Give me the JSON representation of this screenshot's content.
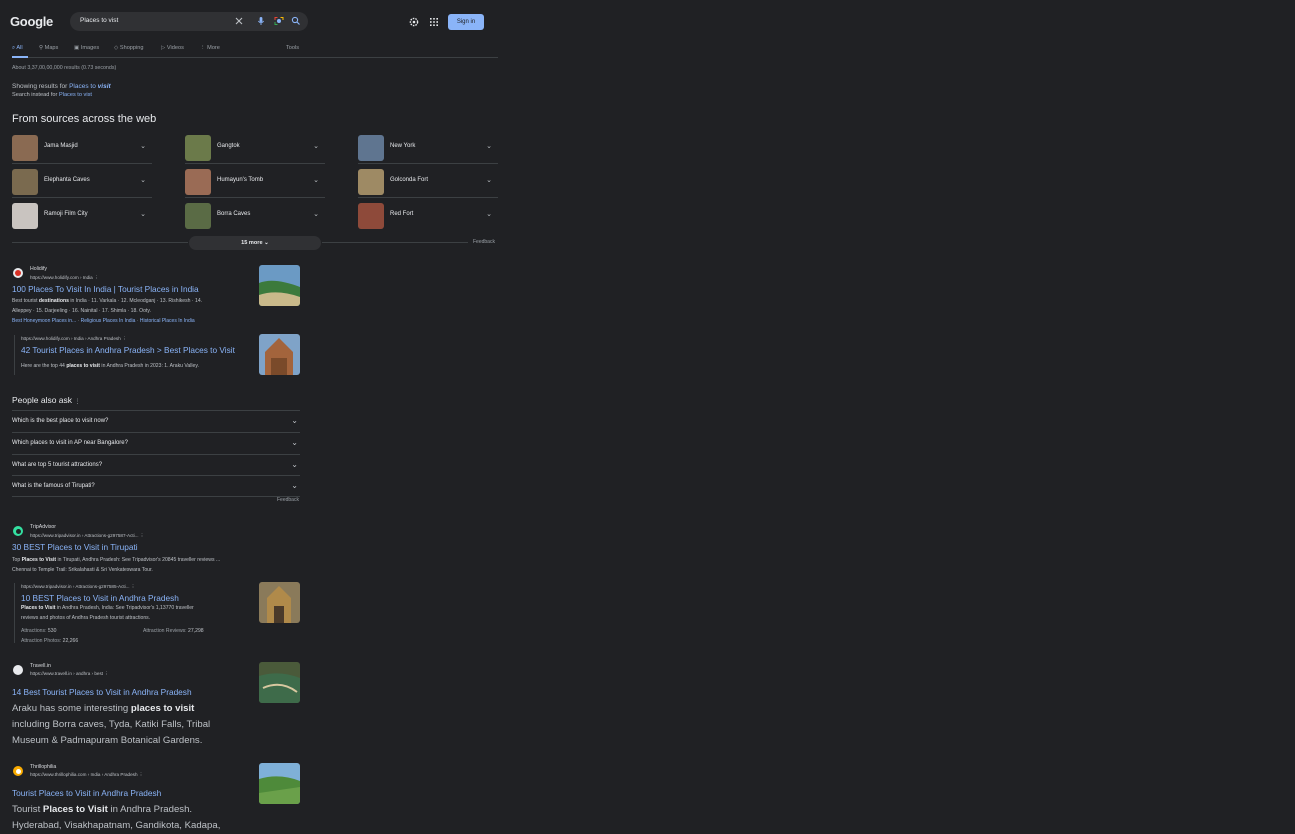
{
  "header": {
    "logo": "Google",
    "query": "Places to vist",
    "signin": "Sign in"
  },
  "tabs": [
    {
      "label": "All"
    },
    {
      "label": "Maps"
    },
    {
      "label": "Images"
    },
    {
      "label": "Shopping"
    },
    {
      "label": "Videos"
    },
    {
      "label": "More"
    },
    {
      "label": "Tools"
    }
  ],
  "stats": "About 3,37,00,00,000 results (0.73 seconds)",
  "correction": {
    "showing_prefix": "Showing results for",
    "showing_plain": "Places to",
    "showing_bold": "visit",
    "instead_prefix": "Search instead for",
    "instead_link": "Places to vist"
  },
  "sources": {
    "heading": "From sources across the web",
    "items": [
      {
        "name": "Jama Masjid",
        "color": "#8a6a52"
      },
      {
        "name": "Gangtok",
        "color": "#6b7a4a"
      },
      {
        "name": "New York",
        "color": "#5f7590"
      },
      {
        "name": "Elephanta Caves",
        "color": "#7a6a4f"
      },
      {
        "name": "Humayun's Tomb",
        "color": "#9a6b55"
      },
      {
        "name": "Golconda Fort",
        "color": "#9e8a64"
      },
      {
        "name": "Ramoji Film City",
        "color": "#c9c4c0"
      },
      {
        "name": "Borra Caves",
        "color": "#5a6b45"
      },
      {
        "name": "Red Fort",
        "color": "#8e4a3a"
      }
    ],
    "more": "15 more",
    "feedback": "Feedback"
  },
  "results": {
    "holidify": {
      "site": "Holidify",
      "url": "https://www.holidify.com › India",
      "title": "100 Places To Visit In India | Tourist Places in India",
      "snippet_1a": "Best tourist ",
      "snippet_1b": "destinations",
      "snippet_1c": " in India · 11. Varkala · 12. Mcleodganj · 13. Rishikesh · 14.",
      "snippet_2": "Alleppey · 15. Darjeeling · 16. Nainital · 17. Shimla · 18. Ooty.",
      "sitelinks": [
        "Best Honeymoon Places in...",
        "Religious Places In India",
        "Historical Places In India"
      ],
      "sub_url": "https://www.holidify.com › India › Andhra Pradesh",
      "sub_title": "42 Tourist Places in Andhra Pradesh > Best Places to Visit",
      "sub_snip_a": "Here are the top 44 ",
      "sub_snip_b": "places to visit",
      "sub_snip_c": " in Andhra Pradesh in 2023: 1. Araku Valley."
    },
    "paa": {
      "heading": "People also ask",
      "questions": [
        "Which is the best place to visit now?",
        "Which places to visit in AP near Bangalore?",
        "What are top 5 tourist attractions?",
        "What is the famous of Tirupati?"
      ],
      "feedback": "Feedback"
    },
    "tripadvisor": {
      "site": "TripAdvisor",
      "url": "https://www.tripadvisor.in › Attractions-g297587-Acti...",
      "title": "30 BEST Places to Visit in Tirupati",
      "snip1_a": "Top ",
      "snip1_b": "Places to Visit",
      "snip1_c": " in Tirupati, Andhra Pradesh: See Tripadvisor's 20845 traveller reviews ...",
      "snip2": "Chennai to Temple Trail: Srikalahasti & Sri Venkateswara Tour.",
      "sub_url": "https://www.tripadvisor.in › Attractions-g297585-Acti...",
      "sub_title": "10 BEST Places to Visit in Andhra Pradesh",
      "sub_snip1_b": "Places to Visit",
      "sub_snip1_c": " in Andhra Pradesh, India: See Tripadvisor's 1,13770 traveller",
      "sub_snip2": "reviews and photos of Andhra Pradesh tourist attractions.",
      "attr_label": "Attractions:",
      "attr_value": "530",
      "reviews_label": "Attraction Reviews:",
      "reviews_value": "27,298",
      "photos_label": "Attraction Photos:",
      "photos_value": "22,266"
    },
    "travelin": {
      "site": "Travell.in",
      "url": "https://www.travell.in › andhra › best",
      "title": "14 Best Tourist Places to Visit in Andhra Pradesh",
      "l1a": "Araku has some interesting ",
      "l1b": "places to visit",
      "l2": "including Borra caves, Tyda, Katiki Falls, Tribal",
      "l3": "Museum & Padmapuram Botanical Gardens."
    },
    "thrillophilia": {
      "site": "Thrillophilia",
      "url": "https://www.thrillophilia.com › India › Andhra Pradesh",
      "title": "Tourist Places to Visit in Andhra Pradesh",
      "l1a": "Tourist ",
      "l1b": "Places to Visit",
      "l1c": " in Andhra Pradesh.",
      "l2": "Hyderabad, Visakhapatnam, Gandikota, Kadapa,"
    }
  }
}
